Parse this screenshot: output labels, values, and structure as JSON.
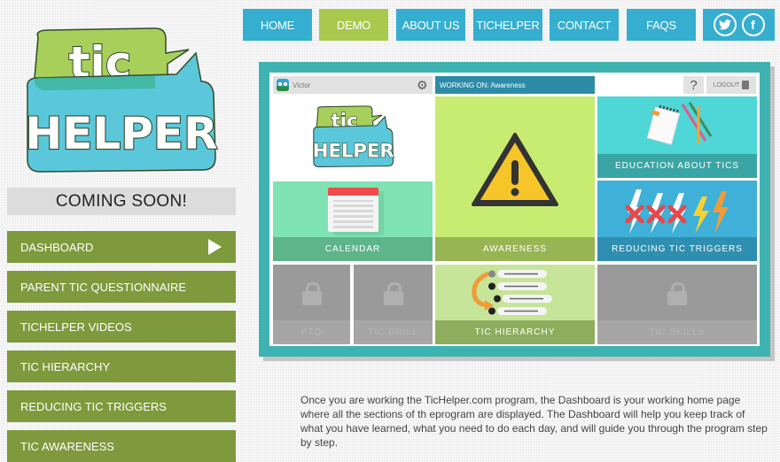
{
  "nav": {
    "items": [
      {
        "label": "HOME",
        "active": false
      },
      {
        "label": "DEMO",
        "active": true
      },
      {
        "label": "ABOUT US",
        "active": false
      },
      {
        "label": "TICHELPER",
        "active": false
      },
      {
        "label": "CONTACT",
        "active": false
      },
      {
        "label": "FAQS",
        "active": false
      }
    ],
    "social": [
      "twitter-icon",
      "facebook-icon"
    ],
    "social_glyphs": {
      "twitter": "🐦",
      "facebook": "f"
    }
  },
  "logo": {
    "top": "tic",
    "bottom": "HELPER"
  },
  "coming_soon": "COMING SOON!",
  "sidebar": {
    "items": [
      {
        "label": "DASHBOARD",
        "active": true
      },
      {
        "label": "PARENT TIC QUESTIONNAIRE"
      },
      {
        "label": "TICHELPER VIDEOS"
      },
      {
        "label": "TIC HIERARCHY"
      },
      {
        "label": "REDUCING TIC TRIGGERS"
      },
      {
        "label": "TIC AWARENESS"
      }
    ]
  },
  "dashboard": {
    "user_name": "Victor",
    "working_on": "WORKING ON: Awareness",
    "help_label": "?",
    "logout_label": "LOGOUT",
    "gear_glyph": "⚙",
    "tiles": {
      "calendar": "CALENDAR",
      "awareness": "AWARENESS",
      "education": "EDUCATION ABOUT TICS",
      "triggers": "REDUCING TIC TRIGGERS",
      "ptq": "PTQ",
      "tic_drill": "TIC DRILL",
      "hierarchy": "TIC HIERARCHY",
      "tic_skills": "TIC SKILLS"
    },
    "colors": {
      "frame": "#3fb3b2",
      "calendar": "#7fe3b3",
      "awareness": "#c8ec72",
      "education": "#4fd6d6",
      "triggers": "#3fb0d8",
      "hierarchy": "#c6e598",
      "locked": "#9a9a9a"
    }
  },
  "description": "Once you are working the TicHelper.com program, the Dashboard is your working home page where all the sections of th eprogram are displayed. The Dashboard will help you keep track of what you have learned, what you need to do each day, and will guide you through the program step by step.",
  "colors": {
    "nav_blue": "#36aed0",
    "nav_active": "#a8c94e",
    "sidebar_green": "#7e9a3c"
  }
}
